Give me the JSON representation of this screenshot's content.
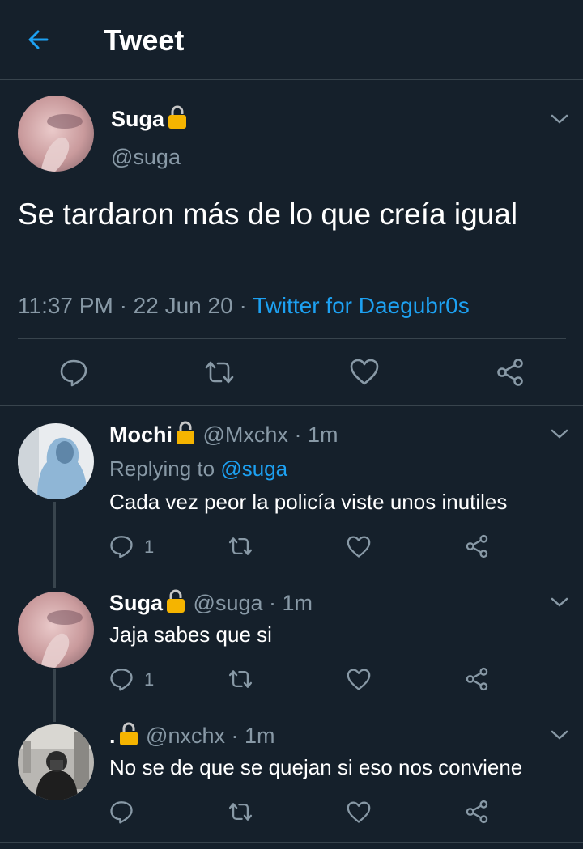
{
  "header": {
    "title": "Tweet",
    "back_icon": "arrow-left-icon",
    "accent": "#1da1f2"
  },
  "main_tweet": {
    "name": "Suga",
    "handle": "@suga",
    "text": "Se tardaron más de lo que creía igual",
    "time": "11:37 PM",
    "date": "22 Jun 20",
    "dot": "·",
    "source": "Twitter for Daegubr0s"
  },
  "replies": [
    {
      "name": "Mochi",
      "handle": "@Mxchx",
      "dot": "·",
      "time": "1m",
      "replying_prefix": "Replying to",
      "replying_handle": "@suga",
      "text": "Cada vez peor la policía viste unos inutiles",
      "reply_count": "1"
    },
    {
      "name": "Suga",
      "handle": "@suga",
      "dot": "·",
      "time": "1m",
      "text": "Jaja sabes que si",
      "reply_count": "1"
    },
    {
      "name": ".",
      "handle": "@nxchx",
      "dot": "·",
      "time": "1m",
      "text": "No se de que se quejan si eso nos conviene",
      "reply_count": ""
    }
  ],
  "colors": {
    "background": "#15202b",
    "border": "#38444d",
    "muted": "#8899a6",
    "link": "#1da1f2",
    "lock": "#f5b400"
  }
}
